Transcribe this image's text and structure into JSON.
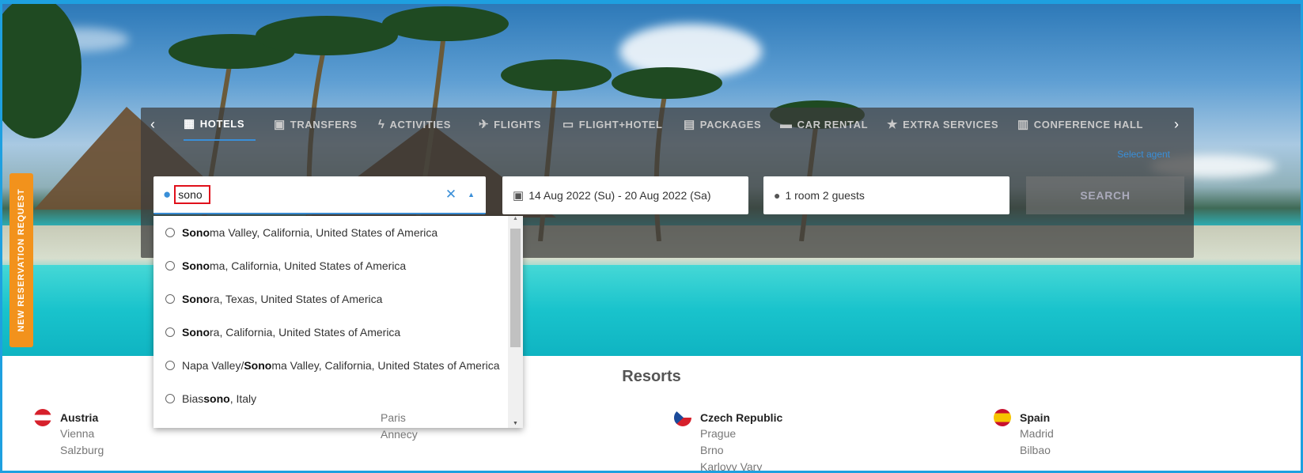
{
  "tabs": [
    {
      "label": "HOTELS",
      "icon": "building-icon",
      "glyph": "▦"
    },
    {
      "label": "TRANSFERS",
      "icon": "bus-icon",
      "glyph": "▣"
    },
    {
      "label": "ACTIVITIES",
      "icon": "lightning-icon",
      "glyph": "ϟ"
    },
    {
      "label": "FLIGHTS",
      "icon": "plane-icon",
      "glyph": "✈"
    },
    {
      "label": "FLIGHT+HOTEL",
      "icon": "ticket-icon",
      "glyph": "▭"
    },
    {
      "label": "PACKAGES",
      "icon": "briefcase-icon",
      "glyph": "▤"
    },
    {
      "label": "CAR RENTAL",
      "icon": "car-icon",
      "glyph": "▬"
    },
    {
      "label": "EXTRA SERVICES",
      "icon": "star-box-icon",
      "glyph": "★"
    },
    {
      "label": "CONFERENCE HALL",
      "icon": "presentation-icon",
      "glyph": "▥"
    }
  ],
  "select_agent": "Select agent",
  "search": {
    "query": "sono",
    "clear_glyph": "✕",
    "toggle_glyph": "▲"
  },
  "dates": {
    "text": "14 Aug 2022 (Su) -  20 Aug 2022 (Sa)"
  },
  "guests": {
    "text": "1 room 2 guests"
  },
  "search_button": "SEARCH",
  "suggestions": [
    {
      "pre": "",
      "match": "Sono",
      "post": "ma Valley, California, United States of America"
    },
    {
      "pre": "",
      "match": "Sono",
      "post": "ma, California, United States of America"
    },
    {
      "pre": "",
      "match": "Sono",
      "post": "ra, Texas, United States of America"
    },
    {
      "pre": "",
      "match": "Sono",
      "post": "ra, California, United States of America"
    },
    {
      "pre": "Napa Valley/",
      "match": "Sono",
      "post": "ma Valley, California, United States of America"
    },
    {
      "pre": "Bias",
      "match": "sono",
      "post": ", Italy"
    }
  ],
  "side_tab": "NEW RESERVATION REQUEST",
  "resorts_title": "Resorts",
  "countries": [
    {
      "name": "Austria",
      "cities": [
        "Vienna",
        "Salzburg"
      ]
    },
    {
      "name": "",
      "cities": [
        "Paris",
        "Annecy"
      ]
    },
    {
      "name": "Czech Republic",
      "cities": [
        "Prague",
        "Brno",
        "Karlovy Vary"
      ]
    },
    {
      "name": "Spain",
      "cities": [
        "Madrid",
        "Bilbao"
      ]
    }
  ],
  "colors": {
    "accent": "#3a8fd8",
    "orange": "#f2921c",
    "frame": "#1ea0e0",
    "highlight_box": "#e0101b"
  }
}
